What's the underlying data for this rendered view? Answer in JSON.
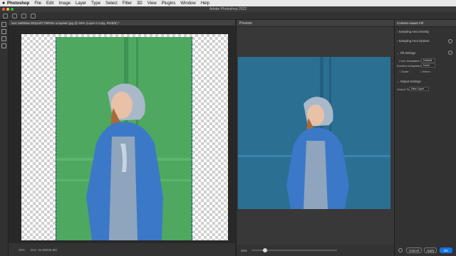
{
  "menubar": {
    "items": [
      "Photoshop",
      "File",
      "Edit",
      "Image",
      "Layer",
      "Type",
      "Select",
      "Filter",
      "3D",
      "View",
      "Plugins",
      "Window",
      "Help"
    ]
  },
  "window": {
    "title": "Adobe Photoshop 2022"
  },
  "document": {
    "tab_label": "ivac 9af55ba-3D/ymhT7MFMx-unsplash.jpg @ 25% (Layer 0 copy, RGB/8) *",
    "zoom": "25%",
    "doc_size": "Doc: 24.9M/29.8M"
  },
  "preview": {
    "title": "Preview",
    "zoom": "25%"
  },
  "panel": {
    "title": "Content-Aware Fill",
    "sampling_overlay": "Sampling Area Overlay",
    "sampling_options": "Sampling Area Options",
    "fill_settings": "Fill Settings",
    "color_adaptation_label": "Color Adaptation:",
    "color_adaptation_value": "Default",
    "rotation_adaptation_label": "Rotation Adaptation:",
    "rotation_adaptation_value": "None",
    "scale_label": "Scale",
    "mirror_label": "Mirror",
    "output_settings": "Output Settings",
    "output_to_label": "Output To:",
    "output_to_value": "New Layer",
    "cancel_label": "Cancel",
    "apply_label": "Apply",
    "ok_label": "OK"
  },
  "colors": {
    "accent": "#1473e6",
    "green_wall": "#4ea860",
    "blue_wall": "#2b6f93"
  }
}
